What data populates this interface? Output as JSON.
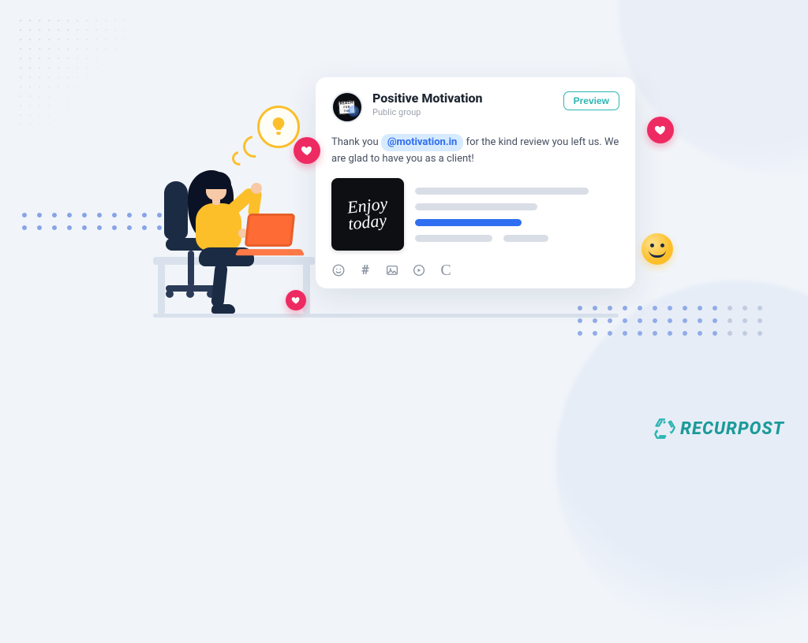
{
  "brand": {
    "name": "RECURPOST"
  },
  "post": {
    "group_name": "Positive Motivation",
    "group_type": "Public group",
    "preview_label": "Preview",
    "text_before": "Thank you ",
    "mention": "@motivation.in",
    "text_after": " for the kind review you left us. We are glad to have you as a client!",
    "thumb_line1": "Enjoy",
    "thumb_line2": "today",
    "avatar_line1": "REACH",
    "avatar_line2": "FOR",
    "avatar_line3": "THE"
  },
  "toolbar": {
    "hash": "#",
    "script_c": "C"
  }
}
